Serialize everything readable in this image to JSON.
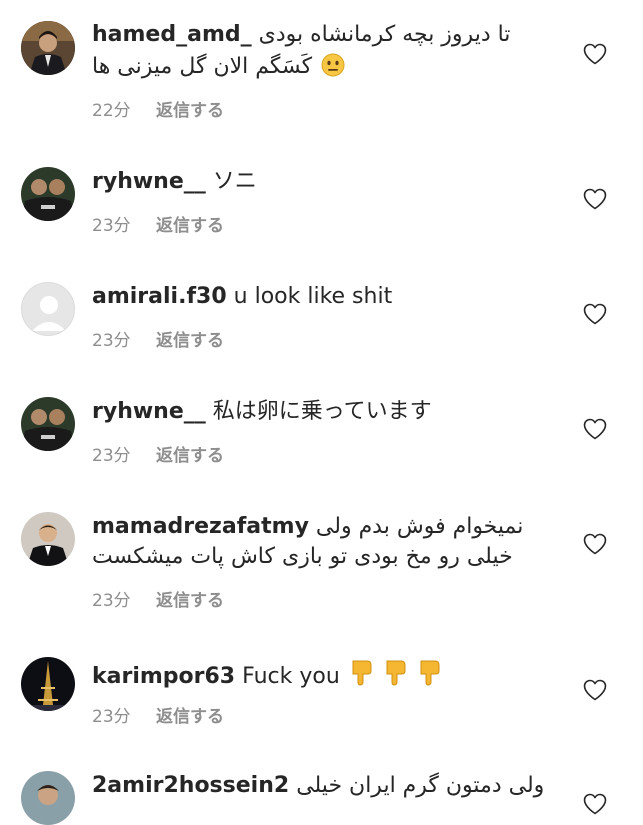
{
  "colors": {
    "text": "#262626",
    "meta": "#8e8e8e",
    "heart_stroke": "#262626"
  },
  "comments": [
    {
      "username": "hamed_amd_",
      "text_line1": "تا دیروز بچه کرمانشاه بودی",
      "text_line2": "کَسَگم الان گل میزنی ها",
      "emoji": "neutral-face",
      "time": "22分",
      "reply_label": "返信する"
    },
    {
      "username": "ryhwne__",
      "text_line1": "ソニ",
      "time": "23分",
      "reply_label": "返信する"
    },
    {
      "username": "amirali.f30",
      "text_line1": "u look like shit",
      "time": "23分",
      "reply_label": "返信する"
    },
    {
      "username": "ryhwne__",
      "text_line1": "私は卵に乗っています",
      "time": "23分",
      "reply_label": "返信する"
    },
    {
      "username": "mamadrezafatmy",
      "text_line1": "نمیخوام فوش بدم ولی",
      "text_line2": "خیلی رو مخ بودی تو بازی کاش پات میشکست",
      "time": "23分",
      "reply_label": "返信する"
    },
    {
      "username": "karimpor63",
      "text_line1": "Fuck you",
      "emoji": "thumbs-down",
      "time": "23分",
      "reply_label": "返信する"
    },
    {
      "username": "2amir2hossein2",
      "text_line1": "ولی دمتون گرم ایران خیلی"
    }
  ]
}
